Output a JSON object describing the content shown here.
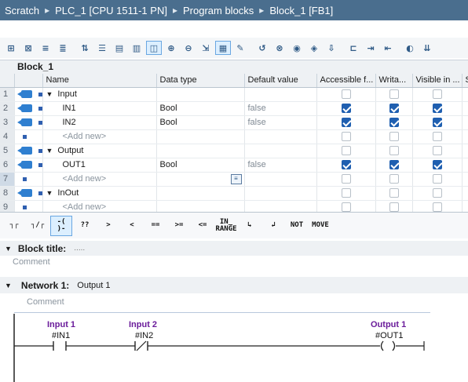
{
  "breadcrumb": {
    "items": [
      "Scratch",
      "PLC_1 [CPU 1511-1 PN]",
      "Program blocks",
      "Block_1 [FB1]"
    ],
    "separator": "▸"
  },
  "toolbar": {
    "icons": [
      "network-insert-icon",
      "network-delete-icon",
      "insert-row-icon",
      "add-row-icon",
      "rewire-icon",
      "absolute-operands-icon",
      "favorites-icon",
      "block-interface-icon",
      "comments-toggle-icon",
      "open-all-networks-icon",
      "close-all-networks-icon",
      "navigate-icon",
      "show-tags-icon",
      "snapshot-icon",
      "monitoring-icon",
      "first-error-icon",
      "next-error-icon",
      "previous-error-icon",
      "compile-icon",
      "ladder-view-icon",
      "indent-icon",
      "outdent-icon",
      "grid-icon",
      "monitor-icon",
      "download-icon"
    ]
  },
  "block": {
    "name": "Block_1"
  },
  "interface": {
    "columns": [
      "",
      "",
      "Name",
      "Data type",
      "Default value",
      "Accessible f...",
      "Writa...",
      "Visible in ...",
      "S"
    ],
    "rows": [
      {
        "num": "1",
        "type": "section",
        "name": "Input",
        "datatype": "",
        "default": "",
        "accessible": false,
        "writable": false,
        "visible": false
      },
      {
        "num": "2",
        "type": "var",
        "name": "IN1",
        "datatype": "Bool",
        "default": "false",
        "accessible": true,
        "writable": true,
        "visible": true
      },
      {
        "num": "3",
        "type": "var",
        "name": "IN2",
        "datatype": "Bool",
        "default": "false",
        "accessible": true,
        "writable": true,
        "visible": true
      },
      {
        "num": "4",
        "type": "add",
        "name": "<Add new>",
        "datatype": "",
        "default": "",
        "accessible": false,
        "writable": false,
        "visible": false
      },
      {
        "num": "5",
        "type": "section",
        "name": "Output",
        "datatype": "",
        "default": "",
        "accessible": false,
        "writable": false,
        "visible": false
      },
      {
        "num": "6",
        "type": "var",
        "name": "OUT1",
        "datatype": "Bool",
        "default": "false",
        "accessible": true,
        "writable": true,
        "visible": true
      },
      {
        "num": "7",
        "type": "add",
        "name": "<Add new>",
        "datatype": "",
        "default": "",
        "accessible": false,
        "writable": false,
        "visible": false
      },
      {
        "num": "8",
        "type": "section",
        "name": "InOut",
        "datatype": "",
        "default": "",
        "accessible": false,
        "writable": false,
        "visible": false
      },
      {
        "num": "9",
        "type": "add",
        "name": "<Add new>",
        "datatype": "",
        "default": "",
        "accessible": false,
        "writable": false,
        "visible": false
      }
    ]
  },
  "lad_toolbar": {
    "buttons": [
      {
        "label": "┐┌",
        "name": "no-contact-button"
      },
      {
        "label": "┐/┌",
        "name": "nc-contact-button"
      },
      {
        "label": "-( )-",
        "name": "coil-button"
      },
      {
        "label": "??",
        "name": "empty-box-button"
      },
      {
        "label": ">",
        "name": "greater-button"
      },
      {
        "label": "<",
        "name": "less-button"
      },
      {
        "label": "==",
        "name": "equal-button"
      },
      {
        "label": ">=",
        "name": "greater-equal-button"
      },
      {
        "label": "<=",
        "name": "less-equal-button"
      },
      {
        "label": "IN_\nRANGE",
        "name": "in-range-button"
      },
      {
        "label": "↳",
        "name": "open-branch-button"
      },
      {
        "label": "↲",
        "name": "close-branch-button"
      },
      {
        "label": "NOT",
        "name": "not-button"
      },
      {
        "label": "MOVE",
        "name": "move-button"
      }
    ]
  },
  "block_title": {
    "label": "Block title:",
    "dots": ".....",
    "comment": "Comment"
  },
  "network": {
    "label": "Network 1:",
    "title": "Output 1",
    "comment": "Comment",
    "contact1": {
      "label": "Input 1",
      "address": "#IN1"
    },
    "contact2": {
      "label": "Input 2",
      "address": "#IN2"
    },
    "coil": {
      "label": "Output 1",
      "address": "#OUT1"
    }
  }
}
